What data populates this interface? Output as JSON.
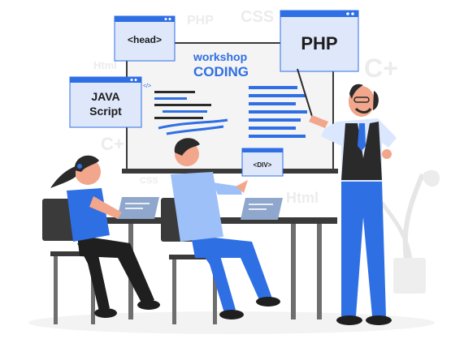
{
  "colors": {
    "accent": "#2f6fe4",
    "accent_light": "#9cc0f7",
    "accent_soft": "#bfd4fb",
    "board": "#f4f4f4",
    "board_border": "#3a3a3a",
    "skin": "#f2a68b",
    "hair": "#2a2a2a",
    "vest": "#2a2a2a",
    "shirt": "#dbe7ff",
    "floor": "#f7f7f7"
  },
  "background_words": {
    "php": "PHP",
    "css_top": "CSS",
    "html_left": "Html",
    "cplus_right": "C+",
    "cplus_left": "C+",
    "css_mid": "CSS",
    "html_right": "Html"
  },
  "cards": {
    "head": "<head>",
    "php": "PHP",
    "java_line1": "JAVA",
    "java_line2": "Script",
    "div": "<DIV>"
  },
  "board": {
    "line1": "workshop",
    "line2": "CODING",
    "code_icon": "</>"
  }
}
